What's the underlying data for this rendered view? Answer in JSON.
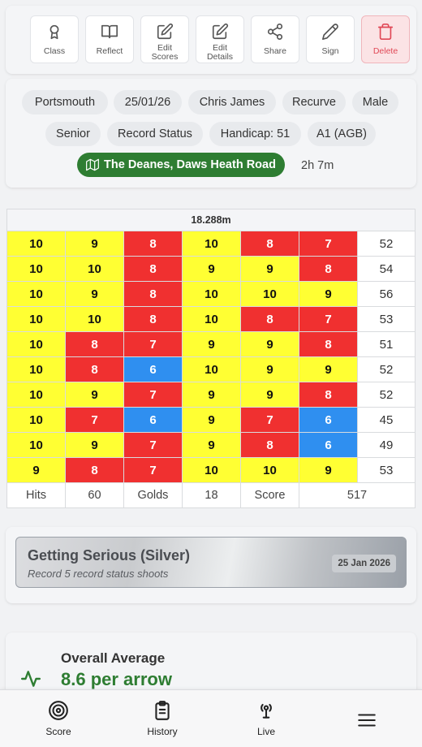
{
  "toolbar": {
    "buttons": [
      {
        "label": "Class",
        "icon": "award-icon"
      },
      {
        "label": "Reflect",
        "icon": "book-icon"
      },
      {
        "label": "Edit\nScores",
        "icon": "edit-icon"
      },
      {
        "label": "Edit\nDetails",
        "icon": "edit-icon"
      },
      {
        "label": "Share",
        "icon": "share-icon"
      },
      {
        "label": "Sign",
        "icon": "pen-icon"
      },
      {
        "label": "Delete",
        "icon": "trash-icon"
      }
    ]
  },
  "info": {
    "chips": [
      "Portsmouth",
      "25/01/26",
      "Chris James",
      "Recurve",
      "Male",
      "Senior",
      "Record Status",
      "Handicap: 51",
      "A1 (AGB)"
    ],
    "venue": "The Deanes, Daws Heath Road",
    "duration": "2h 7m"
  },
  "scorecard": {
    "distance": "18.288m",
    "ends": [
      {
        "arrows": [
          "10",
          "9",
          "8",
          "10",
          "8",
          "7"
        ],
        "total": "52"
      },
      {
        "arrows": [
          "10",
          "10",
          "8",
          "9",
          "9",
          "8"
        ],
        "total": "54"
      },
      {
        "arrows": [
          "10",
          "9",
          "8",
          "10",
          "10",
          "9"
        ],
        "total": "56"
      },
      {
        "arrows": [
          "10",
          "10",
          "8",
          "10",
          "8",
          "7"
        ],
        "total": "53"
      },
      {
        "arrows": [
          "10",
          "8",
          "7",
          "9",
          "9",
          "8"
        ],
        "total": "51"
      },
      {
        "arrows": [
          "10",
          "8",
          "6",
          "10",
          "9",
          "9"
        ],
        "total": "52"
      },
      {
        "arrows": [
          "10",
          "9",
          "7",
          "9",
          "9",
          "8"
        ],
        "total": "52"
      },
      {
        "arrows": [
          "10",
          "7",
          "6",
          "9",
          "7",
          "6"
        ],
        "total": "45"
      },
      {
        "arrows": [
          "10",
          "9",
          "7",
          "9",
          "8",
          "6"
        ],
        "total": "49"
      },
      {
        "arrows": [
          "9",
          "8",
          "7",
          "10",
          "10",
          "9"
        ],
        "total": "53"
      }
    ],
    "totals": {
      "hits_label": "Hits",
      "hits": "60",
      "golds_label": "Golds",
      "golds": "18",
      "score_label": "Score",
      "score": "517"
    },
    "colors": {
      "gold": "#ffff33",
      "red": "#f03030",
      "blue": "#2f8ff0"
    }
  },
  "award": {
    "title": "Getting Serious (Silver)",
    "subtitle": "Record 5 record status shoots",
    "date": "25 Jan 2026"
  },
  "average": {
    "label": "Overall Average",
    "value": "8.6 per arrow",
    "icon": "activity-icon"
  },
  "nav": {
    "items": [
      {
        "label": "Score",
        "icon": "target-icon"
      },
      {
        "label": "History",
        "icon": "clipboard-icon"
      },
      {
        "label": "Live",
        "icon": "broadcast-icon"
      },
      {
        "label": "",
        "icon": "menu-icon"
      }
    ]
  }
}
